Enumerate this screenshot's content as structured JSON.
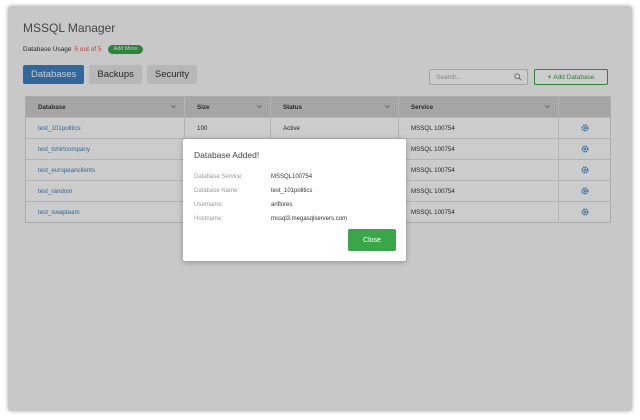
{
  "app": {
    "title": "MSSQL Manager"
  },
  "usage": {
    "label": "Database Usage",
    "count": "5 out of 5",
    "add_more": "Add More"
  },
  "tabs": [
    {
      "label": "Databases",
      "active": true
    },
    {
      "label": "Backups",
      "active": false
    },
    {
      "label": "Security",
      "active": false
    }
  ],
  "search": {
    "placeholder": "Search..."
  },
  "add_database": {
    "label": "Add Database",
    "plus": "+"
  },
  "table": {
    "headers": [
      "Database",
      "Size",
      "Status",
      "Service"
    ],
    "rows": [
      {
        "database": "test_101politics",
        "size": "100",
        "status": "Active",
        "service": "MSSQL 100754"
      },
      {
        "database": "test_tshirtcompany",
        "size": "",
        "status": "",
        "service": "MSSQL 100754"
      },
      {
        "database": "test_europeanclients",
        "size": "",
        "status": "",
        "service": "MSSQL 100754"
      },
      {
        "database": "test_random",
        "size": "",
        "status": "",
        "service": "MSSQL 100754"
      },
      {
        "database": "test_swapteam",
        "size": "",
        "status": "",
        "service": "MSSQL 100754"
      }
    ]
  },
  "modal": {
    "title": "Database Added!",
    "fields": [
      {
        "label": "Database Service:",
        "value": "MSSQL100754"
      },
      {
        "label": "Database Name:",
        "value": "test_101politics"
      },
      {
        "label": "Username:",
        "value": "anflores"
      },
      {
        "label": "Hostname:",
        "value": "mssql3.megasqlservers.com"
      }
    ],
    "close": "Close"
  },
  "colors": {
    "primary": "#3b82c4",
    "success": "#3aa64a",
    "danger": "#d9534f"
  }
}
